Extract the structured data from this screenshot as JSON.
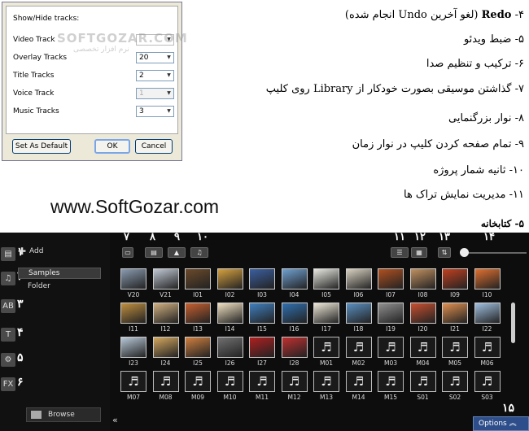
{
  "dialog": {
    "title": "Show/Hide tracks:",
    "rows": [
      {
        "label": "Video Track",
        "value": "",
        "disabled": false
      },
      {
        "label": "Overlay Tracks",
        "value": "20",
        "disabled": false
      },
      {
        "label": "Title Tracks",
        "value": "2",
        "disabled": false
      },
      {
        "label": "Voice Track",
        "value": "1",
        "disabled": true
      },
      {
        "label": "Music Tracks",
        "value": "3",
        "disabled": false
      }
    ],
    "set_default": "Set As Default",
    "ok": "OK",
    "cancel": "Cancel",
    "watermark": "SOFTGOZAR.COM",
    "watermark_sub": "نرم افزار تخصصی"
  },
  "list": [
    {
      "num": "۴-",
      "text_bold": "Redo",
      "text": " (لغو آخرین Undo انجام شده)"
    },
    {
      "num": "۵-",
      "text_bold": "",
      "text": " ضبط ویدئو"
    },
    {
      "num": "۶-",
      "text_bold": "",
      "text": " ترکیب و تنظیم صدا"
    },
    {
      "num": "۷-",
      "text_bold": "",
      "text": " گذاشتن موسیقی بصورت خودکار از  Library روی کلیپ"
    },
    {
      "num": "۸-",
      "text_bold": "",
      "text": " نوار بزرگنمایی"
    },
    {
      "num": "۹-",
      "text_bold": "",
      "text": " تمام صفحه کردن کلیپ در نوار زمان"
    },
    {
      "num": "۱۰-",
      "text_bold": "",
      "text": " ثانیه شمار پروژه"
    },
    {
      "num": "۱۱-",
      "text_bold": "",
      "text": " مدیریت نمایش تراک ها"
    }
  ],
  "site": "www.SoftGozar.com",
  "library_heading": "۵- کتابخانه",
  "library": {
    "add": "Add",
    "samples": "Samples",
    "folder": "Folder",
    "browse": "Browse",
    "options": "Options",
    "side_numbers": [
      "۱",
      "۲",
      "۳",
      "۴",
      "۵",
      "۶"
    ],
    "side_icons": [
      "▤",
      "♫",
      "AB",
      "T",
      "⚙",
      "FX"
    ],
    "toolbar_numbers": [
      "۷",
      "۸",
      "۹",
      "۱۰",
      "۱۱",
      "۱۲",
      "۱۳",
      "۱۴"
    ],
    "num15": "۱۵",
    "items": [
      "V20",
      "V21",
      "I01",
      "I02",
      "I03",
      "I04",
      "I05",
      "I06",
      "I07",
      "I08",
      "I09",
      "I10",
      "I11",
      "I12",
      "I13",
      "I14",
      "I15",
      "I16",
      "I17",
      "I18",
      "I19",
      "I20",
      "I21",
      "I22",
      "I23",
      "I24",
      "I25",
      "I26",
      "I27",
      "I28",
      "M01",
      "M02",
      "M03",
      "M04",
      "M05",
      "M06",
      "M07",
      "M08",
      "M09",
      "M10",
      "M11",
      "M12",
      "M13",
      "M14",
      "M15",
      "S01",
      "S02",
      "S03"
    ],
    "thumb_colors": [
      "#8a9bb0",
      "#c0c8d4",
      "#6b4a2a",
      "#d4a040",
      "#3b5fa0",
      "#6fa0d0",
      "#e8e8e0",
      "#d8d0c0",
      "#b05020",
      "#c09060",
      "#c04020",
      "#e07030",
      "#c09040",
      "#d0b080",
      "#c86030",
      "#f0e0c0",
      "#4080c0",
      "#3070b0",
      "#eee8d8",
      "#5a90c0",
      "#909090",
      "#c85030",
      "#e09050",
      "#a0c0e0",
      "#b8c8d8",
      "#d4a860",
      "#d08040",
      "#707070",
      "#b02020",
      "#c03030"
    ]
  }
}
